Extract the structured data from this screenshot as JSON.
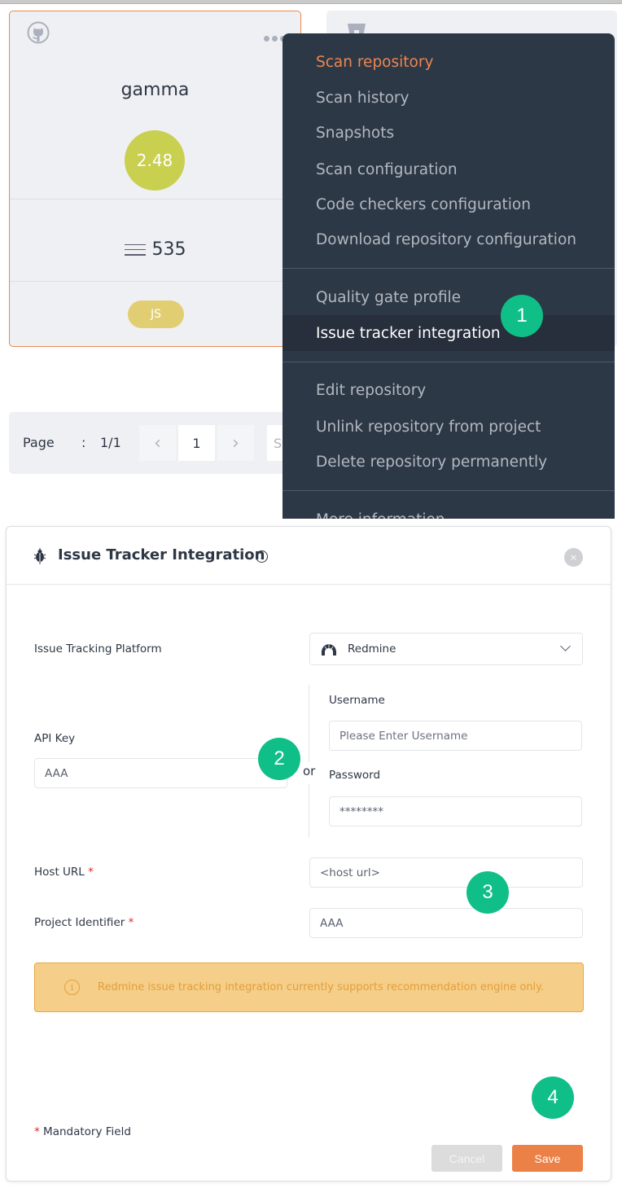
{
  "repo_card": {
    "name": "gamma",
    "score": "2.48",
    "lines": "535",
    "language": "JS",
    "source_icon": "github-icon",
    "menu_icon": "more-dots-icon",
    "score_color": "#c9cf4f",
    "border_color": "#ec8650"
  },
  "second_card": {
    "source_icon": "bitbucket-icon",
    "menu_icon": "more-dots-icon"
  },
  "pagination": {
    "label": "Page",
    "separator": ":",
    "total": "1/1",
    "prev_icon": "‹",
    "current": "1",
    "next_icon": "›",
    "page_size_partial": "S"
  },
  "context_menu": {
    "groups": [
      [
        {
          "label": "Scan repository",
          "state": "accent"
        },
        {
          "label": "Scan history"
        },
        {
          "label": "Snapshots"
        },
        {
          "label": "Scan configuration"
        },
        {
          "label": "Code checkers configuration"
        },
        {
          "label": "Download repository configuration"
        }
      ],
      [
        {
          "label": "Quality gate profile"
        },
        {
          "label": "Issue tracker integration",
          "state": "active"
        }
      ],
      [
        {
          "label": "Edit repository"
        },
        {
          "label": "Unlink repository from project"
        },
        {
          "label": "Delete repository permanently"
        }
      ],
      [
        {
          "label": "More information"
        }
      ]
    ]
  },
  "steps": [
    "1",
    "2",
    "3",
    "4"
  ],
  "modal": {
    "title": "Issue Tracker Integration",
    "title_icon": "bug-icon",
    "info_icon": "i",
    "close_icon": "×",
    "fields": {
      "platform": {
        "label": "Issue Tracking Platform",
        "value": "Redmine",
        "icon": "redmine-icon"
      },
      "api_key": {
        "label": "API Key",
        "value": "AAA"
      },
      "or_text": "or",
      "username": {
        "label": "Username",
        "placeholder": "Please Enter Username"
      },
      "password": {
        "label": "Password",
        "value": "********"
      },
      "host_url": {
        "label": "Host URL",
        "required": "*",
        "value": "<host url>"
      },
      "project_identifier": {
        "label": "Project Identifier",
        "required": "*",
        "value": "AAA"
      }
    },
    "alert": {
      "icon": "i",
      "text": "Redmine issue tracking integration currently supports recommendation engine only."
    },
    "footer": {
      "mandatory_star": "*",
      "mandatory_text": "Mandatory Field",
      "cancel_label": "Cancel",
      "save_label": "Save"
    }
  },
  "colors": {
    "accent": "#ec8650",
    "step_badge": "#10bf87",
    "menu_bg": "#2d3846",
    "alert_bg": "#f5ce89"
  }
}
